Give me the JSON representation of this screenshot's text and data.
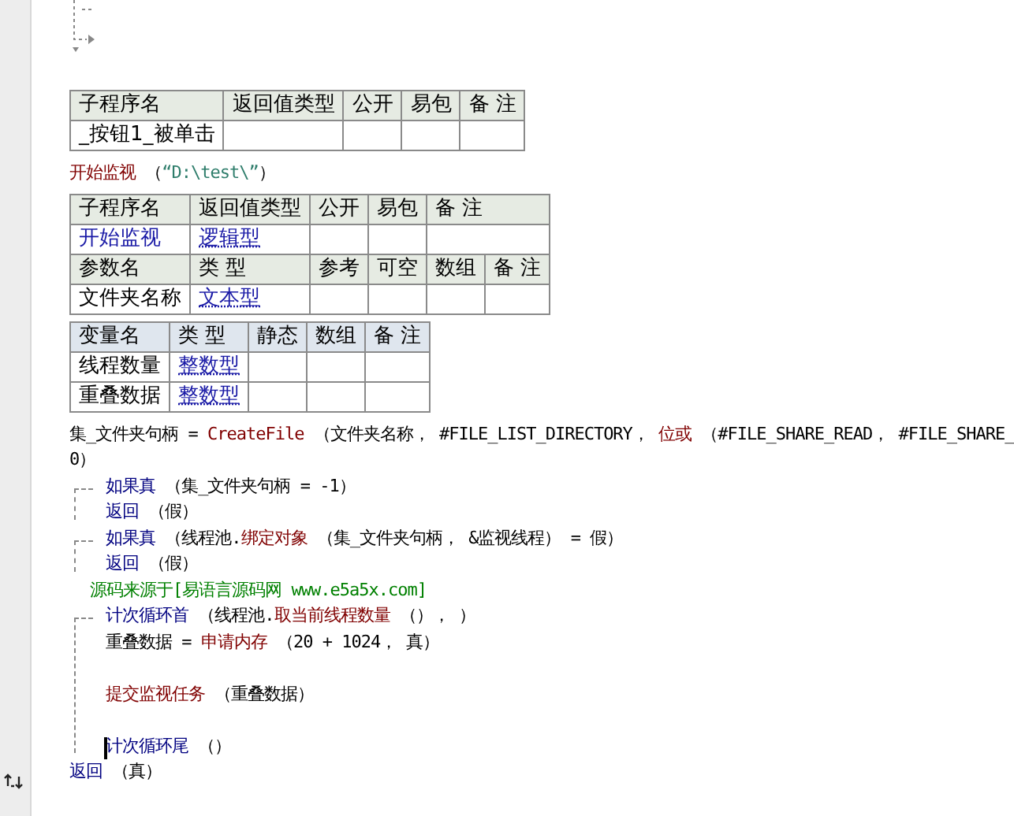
{
  "tables": [
    {
      "kind": "sub",
      "rows": [
        {
          "kind": "header",
          "cells": [
            {
              "text": "子程序名",
              "kind": "plain"
            },
            {
              "text": "返回值类型",
              "kind": "plain"
            },
            {
              "text": "公开",
              "kind": "plain"
            },
            {
              "text": "易包",
              "kind": "plain"
            },
            {
              "text": "备 注",
              "kind": "plain"
            }
          ]
        },
        {
          "kind": "data",
          "cells": [
            {
              "text": "_按钮1_被单击",
              "kind": "plain"
            },
            {
              "text": "",
              "kind": "plain"
            },
            {
              "text": "",
              "kind": "plain"
            },
            {
              "text": "",
              "kind": "plain"
            },
            {
              "text": "",
              "kind": "plain"
            }
          ]
        }
      ]
    },
    {
      "kind": "call",
      "parts": [
        {
          "kind": "call",
          "text": "开始监视"
        },
        {
          "kind": "plain",
          "text": " （"
        },
        {
          "kind": "str",
          "text": "“D:\\test\\”"
        },
        {
          "kind": "plain",
          "text": "）"
        }
      ]
    },
    {
      "kind": "sub",
      "rows": [
        {
          "kind": "header",
          "cells": [
            {
              "text": "子程序名",
              "kind": "plain"
            },
            {
              "text": "返回值类型",
              "kind": "plain"
            },
            {
              "text": "公开",
              "kind": "plain"
            },
            {
              "text": "易包",
              "kind": "plain"
            },
            {
              "text": "备 注",
              "kind": "plain",
              "colspan": 2
            }
          ]
        },
        {
          "kind": "data",
          "cells": [
            {
              "text": "开始监视",
              "kind": "name"
            },
            {
              "text": "逻辑型",
              "kind": "type"
            },
            {
              "text": "",
              "kind": "plain"
            },
            {
              "text": "",
              "kind": "plain"
            },
            {
              "text": "",
              "kind": "plain",
              "colspan": 2
            }
          ]
        },
        {
          "kind": "header",
          "cells": [
            {
              "text": "参数名",
              "kind": "plain"
            },
            {
              "text": "类 型",
              "kind": "plain"
            },
            {
              "text": "参考",
              "kind": "plain"
            },
            {
              "text": "可空",
              "kind": "plain"
            },
            {
              "text": "数组",
              "kind": "plain"
            },
            {
              "text": "备 注",
              "kind": "plain"
            }
          ]
        },
        {
          "kind": "data",
          "cells": [
            {
              "text": "文件夹名称",
              "kind": "plain"
            },
            {
              "text": "文本型",
              "kind": "type"
            },
            {
              "text": "",
              "kind": "plain"
            },
            {
              "text": "",
              "kind": "plain"
            },
            {
              "text": "",
              "kind": "plain"
            },
            {
              "text": "",
              "kind": "plain"
            }
          ]
        }
      ]
    },
    {
      "kind": "var",
      "rows": [
        {
          "kind": "header",
          "cells": [
            {
              "text": "变量名",
              "kind": "plain"
            },
            {
              "text": "类 型",
              "kind": "plain"
            },
            {
              "text": "静态",
              "kind": "plain"
            },
            {
              "text": "数组",
              "kind": "plain"
            },
            {
              "text": "备 注",
              "kind": "plain"
            }
          ]
        },
        {
          "kind": "data",
          "cells": [
            {
              "text": "线程数量",
              "kind": "plain"
            },
            {
              "text": "整数型",
              "kind": "type"
            },
            {
              "text": "",
              "kind": "plain"
            },
            {
              "text": "",
              "kind": "plain"
            },
            {
              "text": "",
              "kind": "plain"
            }
          ]
        },
        {
          "kind": "data",
          "cells": [
            {
              "text": "重叠数据",
              "kind": "plain"
            },
            {
              "text": "整数型",
              "kind": "type"
            },
            {
              "text": "",
              "kind": "plain"
            },
            {
              "text": "",
              "kind": "plain"
            },
            {
              "text": "",
              "kind": "plain"
            }
          ]
        }
      ]
    }
  ],
  "code": [
    {
      "kind": "stmt",
      "parts": [
        {
          "kind": "plain",
          "text": "集_文件夹句柄 = "
        },
        {
          "kind": "call",
          "text": "CreateFile"
        },
        {
          "kind": "plain",
          "text": " （文件夹名称， #FILE_LIST_DIRECTORY， "
        },
        {
          "kind": "call",
          "text": "位或"
        },
        {
          "kind": "plain",
          "text": " （#FILE_SHARE_READ， #FILE_SHARE_"
        }
      ]
    },
    {
      "kind": "stmt",
      "parts": [
        {
          "kind": "plain",
          "text": "0）"
        }
      ]
    },
    {
      "kind": "block",
      "head": [
        {
          "kind": "cmd",
          "text": "如果真"
        },
        {
          "kind": "plain",
          "text": " （集_文件夹句柄 = -1）"
        }
      ],
      "children": [
        {
          "kind": "stmt",
          "parts": [
            {
              "kind": "cmd",
              "text": "返回"
            },
            {
              "kind": "plain",
              "text": " （假）"
            }
          ]
        }
      ]
    },
    {
      "kind": "block",
      "head": [
        {
          "kind": "cmd",
          "text": "如果真"
        },
        {
          "kind": "plain",
          "text": " （线程池."
        },
        {
          "kind": "call",
          "text": "绑定对象"
        },
        {
          "kind": "plain",
          "text": " （集_文件夹句柄， &监视线程） = 假）"
        }
      ],
      "children": [
        {
          "kind": "stmt",
          "parts": [
            {
              "kind": "cmd",
              "text": "返回"
            },
            {
              "kind": "plain",
              "text": " （假）"
            }
          ]
        }
      ]
    },
    {
      "kind": "comment",
      "parts": [
        {
          "kind": "comment",
          "text": "源码来源于[易语言源码网 www.e5a5x.com]"
        }
      ]
    },
    {
      "kind": "block",
      "head": [
        {
          "kind": "cmd",
          "text": "计次循环首"
        },
        {
          "kind": "plain",
          "text": " （线程池."
        },
        {
          "kind": "call",
          "text": "取当前线程数量"
        },
        {
          "kind": "plain",
          "text": " （）， ）"
        }
      ],
      "children": [
        {
          "kind": "stmt",
          "parts": [
            {
              "kind": "plain",
              "text": "重叠数据 = "
            },
            {
              "kind": "call",
              "text": "申请内存"
            },
            {
              "kind": "plain",
              "text": " （20 + 1024， 真）"
            }
          ]
        },
        {
          "kind": "blank"
        },
        {
          "kind": "stmt",
          "parts": [
            {
              "kind": "call",
              "text": "提交监视任务"
            },
            {
              "kind": "plain",
              "text": " （重叠数据）"
            }
          ]
        },
        {
          "kind": "blank"
        },
        {
          "kind": "end",
          "cursor": true,
          "parts": [
            {
              "kind": "cmd",
              "text": "计次循环尾"
            },
            {
              "kind": "plain",
              "text": " （）"
            }
          ]
        }
      ]
    },
    {
      "kind": "stmt",
      "parts": [
        {
          "kind": "cmd",
          "text": "返回"
        },
        {
          "kind": "plain",
          "text": " （真）"
        }
      ]
    }
  ]
}
